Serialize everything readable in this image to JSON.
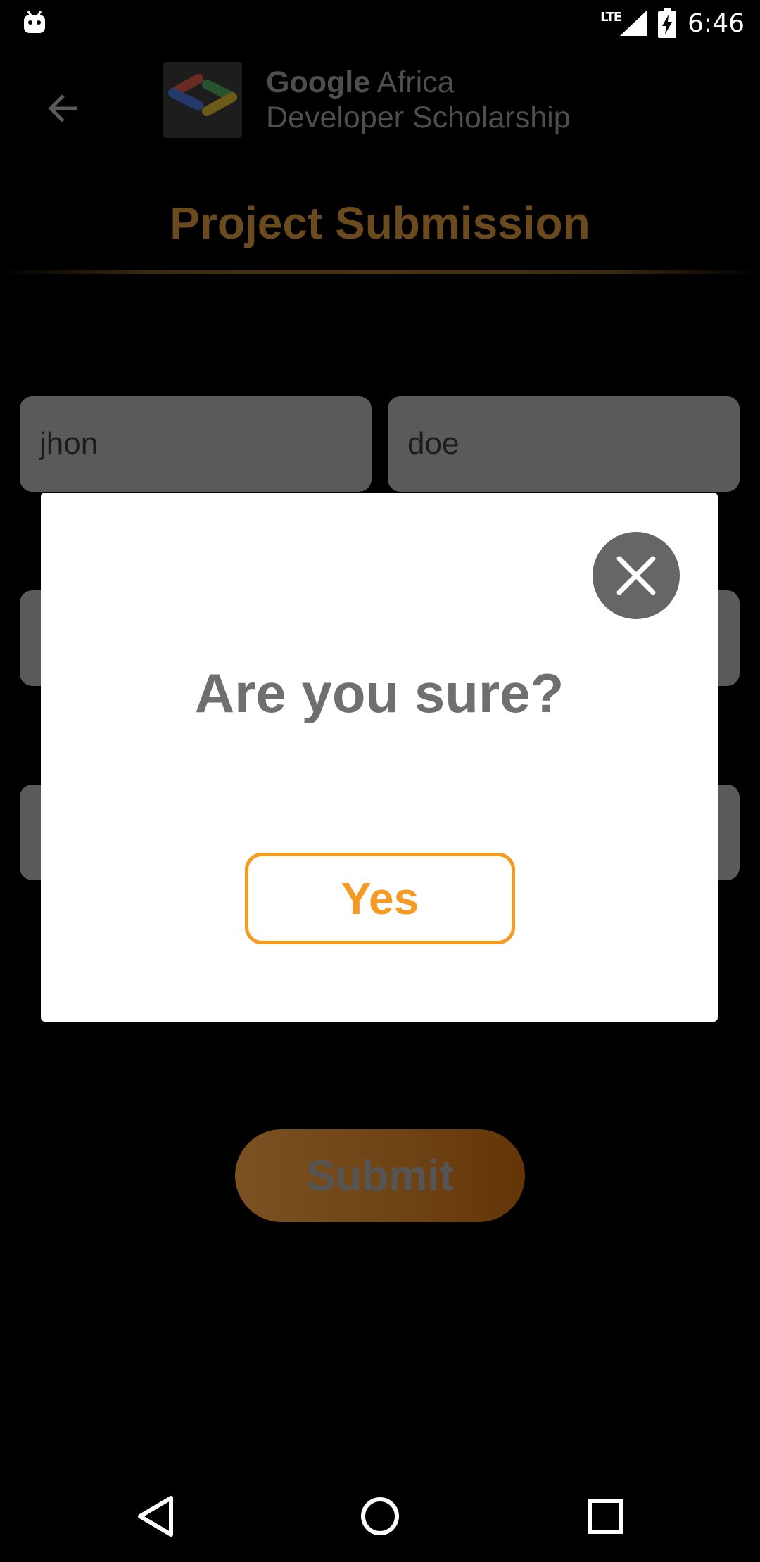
{
  "status_bar": {
    "network": "LTE",
    "time": "6:46"
  },
  "app_bar": {
    "brand_line1_google": "Google",
    "brand_line1_rest": " Africa",
    "brand_line2": "Developer Scholarship"
  },
  "page": {
    "title": "Project Submission"
  },
  "form": {
    "first_name": "jhon",
    "last_name": "doe",
    "submit_label": "Submit"
  },
  "dialog": {
    "title": "Are you sure?",
    "confirm_label": "Yes"
  },
  "colors": {
    "accent": "#f59a23",
    "title_dimmed": "#6b4a1e",
    "dialog_text": "#6f6f6f"
  },
  "icons": {
    "back": "arrow-left-icon",
    "close": "close-icon",
    "nav_back": "triangle-back-icon",
    "nav_home": "circle-home-icon",
    "nav_recents": "square-recents-icon"
  }
}
